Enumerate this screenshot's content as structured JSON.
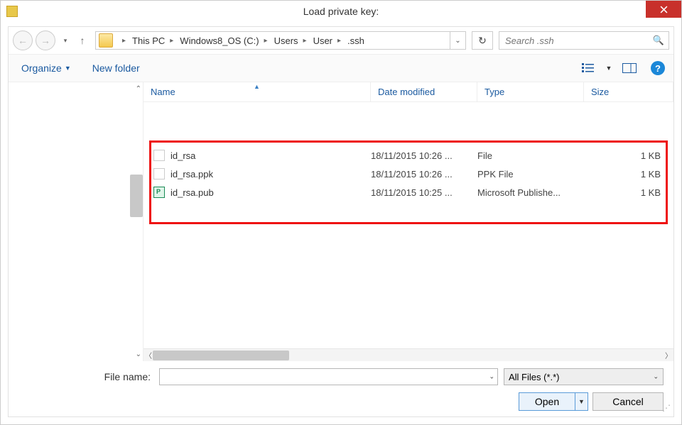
{
  "window": {
    "title": "Load private key:"
  },
  "nav": {
    "breadcrumbs": [
      "This PC",
      "Windows8_OS (C:)",
      "Users",
      "User",
      ".ssh"
    ]
  },
  "search": {
    "placeholder": "Search .ssh"
  },
  "toolbar": {
    "organize": "Organize",
    "newfolder": "New folder"
  },
  "columns": {
    "name": "Name",
    "date": "Date modified",
    "type": "Type",
    "size": "Size"
  },
  "files": [
    {
      "name": "id_rsa",
      "date": "18/11/2015 10:26 ...",
      "type": "File",
      "size": "1 KB",
      "icon": "file"
    },
    {
      "name": "id_rsa.ppk",
      "date": "18/11/2015 10:26 ...",
      "type": "PPK File",
      "size": "1 KB",
      "icon": "file"
    },
    {
      "name": "id_rsa.pub",
      "date": "18/11/2015 10:25 ...",
      "type": "Microsoft Publishe...",
      "size": "1 KB",
      "icon": "pub"
    }
  ],
  "bottom": {
    "filename_label": "File name:",
    "filename_value": "",
    "filter": "All Files (*.*)",
    "open": "Open",
    "cancel": "Cancel"
  }
}
